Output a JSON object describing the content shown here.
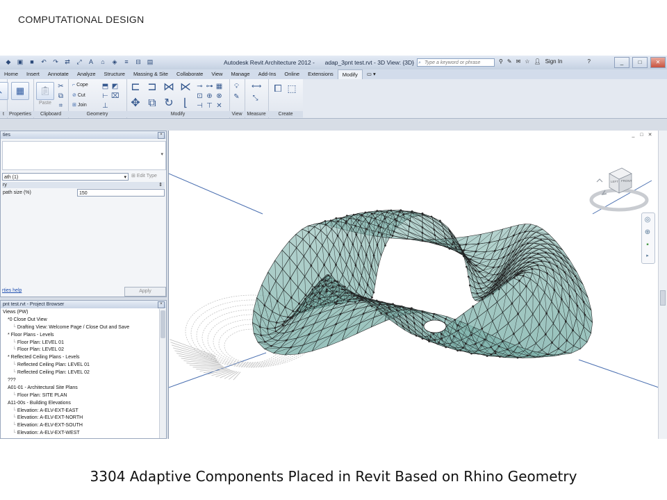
{
  "slide": {
    "header": "COMPUTATIONAL DESIGN",
    "caption": "3304 Adaptive Components Placed in Revit Based on Rhino Geometry"
  },
  "window": {
    "title": "Autodesk Revit Architecture 2012 -",
    "file_title": "adap_3pnt test.rvt - 3D View: {3D}",
    "search_placeholder": "Type a keyword or phrase",
    "sign_in": "Sign In",
    "help_icon": "?",
    "minimize": "_",
    "maximize": "□",
    "close": "✕"
  },
  "ribbon": {
    "tabs": [
      "Home",
      "Insert",
      "Annotate",
      "Analyze",
      "Structure",
      "Massing & Site",
      "Collaborate",
      "View",
      "Manage",
      "Add-Ins",
      "Online",
      "Extensions",
      "Modify"
    ],
    "active_tab": "Modify",
    "panels": {
      "select_label": "t",
      "properties_label": "Properties",
      "clipboard_label": "Clipboard",
      "paste_label": "Paste",
      "geometry_label": "Geometry",
      "cope_label": "Cope",
      "cut_label": "Cut",
      "join_label": "Join",
      "modify_label": "Modify",
      "view_label": "View",
      "measure_label": "Measure",
      "create_label": "Create"
    }
  },
  "properties": {
    "header": "ties",
    "type_value": "ath (1)",
    "edit_type": "Edit Type",
    "category": "ry",
    "param_label": "path size (%)",
    "param_value": "150",
    "help_link": "rties help",
    "apply": "Apply"
  },
  "project_browser": {
    "header": "pnt test.rvt - Project Browser",
    "items": [
      "Views (PW)",
      "*0 Close Out View",
      "Drafting View: Welcome Page / Close Out and Save",
      "* Floor Plans - Levels",
      "Floor Plan: LEVEL 01",
      "Floor Plan: LEVEL 02",
      "* Reflected Ceiling Plans - Levels",
      "Reflected Ceiling Plan: LEVEL 01",
      "Reflected Ceiling Plan: LEVEL 02",
      "???",
      "A01-01 - Architectural Site Plans",
      "Floor Plan: SITE PLAN",
      "A11-00s - Building Elevations",
      "Elevation: A-ELV-EXT-EAST",
      "Elevation: A-ELV-EXT-NORTH",
      "Elevation: A-ELV-EXT-SOUTH",
      "Elevation: A-ELV-EXT-WEST"
    ],
    "indents": [
      0,
      1,
      2,
      1,
      2,
      2,
      1,
      2,
      2,
      1,
      1,
      2,
      1,
      2,
      2,
      2,
      2
    ]
  },
  "viewport": {
    "viewcube_left": "LEFT",
    "viewcube_front": "FRONT",
    "surface_color": "#7fb3ac",
    "grid_line_color": "#1a1a1a",
    "ghost_color": "#bdbdbd",
    "axis_color": "#4a6fb0",
    "controls": [
      "_",
      "□",
      "✕"
    ]
  }
}
